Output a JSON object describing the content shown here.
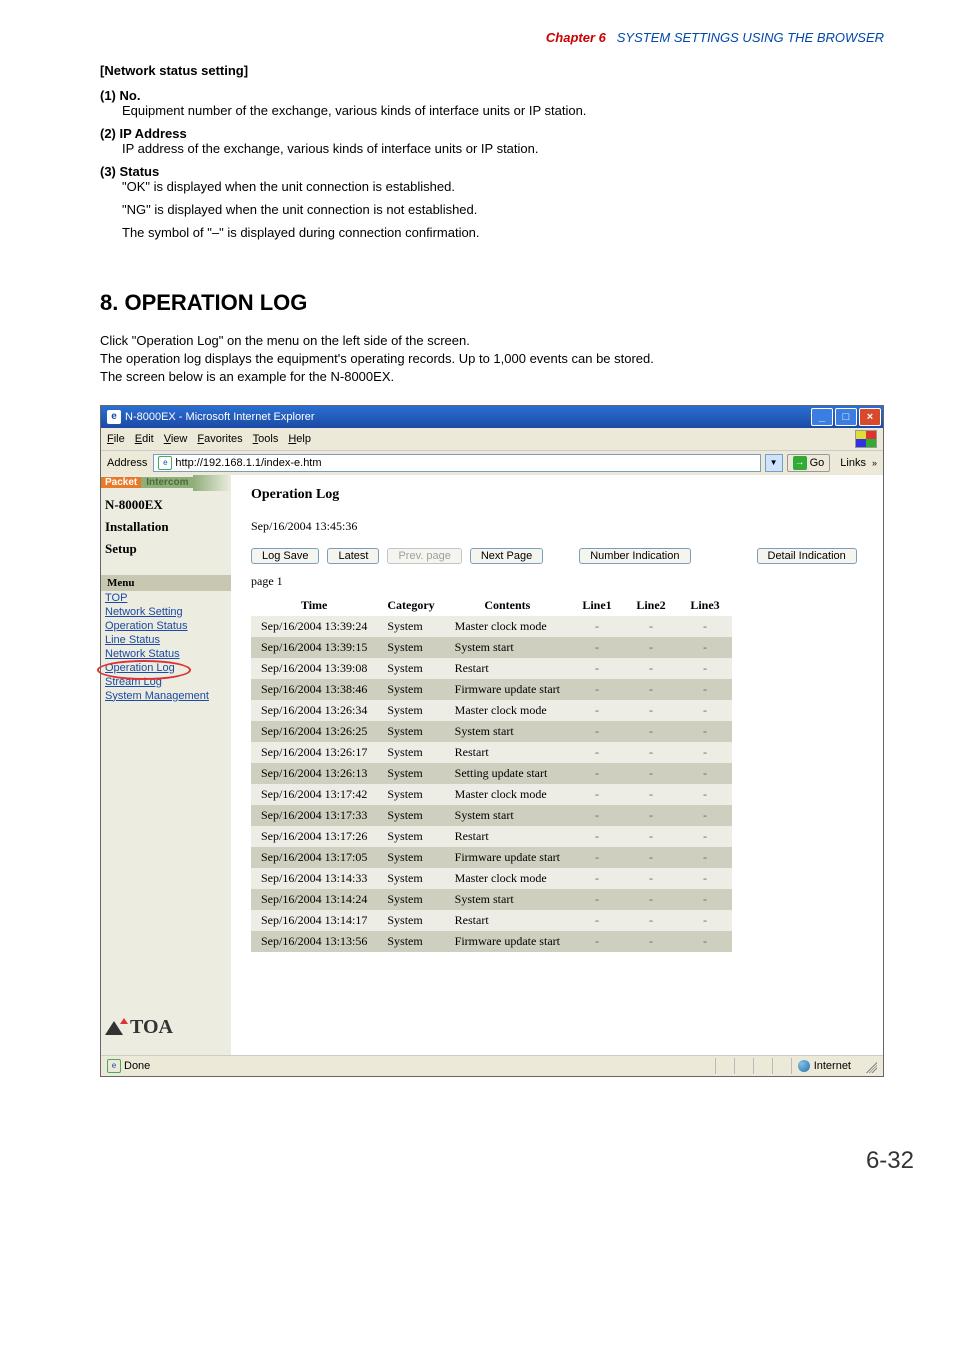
{
  "chapter": {
    "label": "Chapter 6",
    "title": "SYSTEM SETTINGS USING THE BROWSER"
  },
  "subheading": "[Network status setting]",
  "items": [
    {
      "num": "(1)",
      "label": "No.",
      "desc": "Equipment number of the exchange, various kinds of interface units or IP station."
    },
    {
      "num": "(2)",
      "label": "IP Address",
      "desc": "IP address of the exchange, various kinds of interface units or IP station."
    },
    {
      "num": "(3)",
      "label": "Status",
      "lines": [
        "\"OK\" is displayed when the unit connection is established.",
        "\"NG\" is displayed when the unit connection is not established.",
        "The symbol of \"–\" is displayed during connection confirmation."
      ]
    }
  ],
  "section8": {
    "heading": "8. OPERATION LOG",
    "para": [
      "Click \"Operation Log\" on the menu on the left side of the screen.",
      "The operation log displays the equipment's operating records. Up to 1,000 events can be stored.",
      "The screen below is an example for the N-8000EX."
    ]
  },
  "browser": {
    "title": "N-8000EX - Microsoft Internet Explorer",
    "menus": [
      "File",
      "Edit",
      "View",
      "Favorites",
      "Tools",
      "Help"
    ],
    "addr_label": "Address",
    "url": "http://192.168.1.1/index-e.htm",
    "go_label": "Go",
    "links_label": "Links",
    "status_done": "Done",
    "status_zone": "Internet"
  },
  "sidebar": {
    "brand1": "Packet",
    "brand2": "Intercom",
    "model": "N-8000EX",
    "line1": "Installation",
    "line2": "Setup",
    "menu_label": "Menu",
    "links": [
      "TOP",
      "Network Setting",
      "Operation Status",
      "Line Status",
      "Network Status",
      "Operation Log",
      "Stream Log",
      "System Management"
    ],
    "logo": "TOA"
  },
  "main": {
    "heading": "Operation Log",
    "timestamp": "Sep/16/2004 13:45:36",
    "buttons": {
      "log_save": "Log Save",
      "latest": "Latest",
      "prev": "Prev. page",
      "next": "Next Page",
      "number": "Number Indication",
      "detail": "Detail Indication"
    },
    "page_label": "page 1",
    "headers": [
      "Time",
      "Category",
      "Contents",
      "Line1",
      "Line2",
      "Line3"
    ],
    "rows": [
      {
        "t": "Sep/16/2004 13:39:24",
        "cat": "System",
        "c": "Master clock mode",
        "l1": "-",
        "l2": "-",
        "l3": "-"
      },
      {
        "t": "Sep/16/2004 13:39:15",
        "cat": "System",
        "c": "System start",
        "l1": "-",
        "l2": "-",
        "l3": "-"
      },
      {
        "t": "Sep/16/2004 13:39:08",
        "cat": "System",
        "c": "Restart",
        "l1": "-",
        "l2": "-",
        "l3": "-"
      },
      {
        "t": "Sep/16/2004 13:38:46",
        "cat": "System",
        "c": "Firmware update start",
        "l1": "-",
        "l2": "-",
        "l3": "-"
      },
      {
        "t": "Sep/16/2004 13:26:34",
        "cat": "System",
        "c": "Master clock mode",
        "l1": "-",
        "l2": "-",
        "l3": "-"
      },
      {
        "t": "Sep/16/2004 13:26:25",
        "cat": "System",
        "c": "System start",
        "l1": "-",
        "l2": "-",
        "l3": "-"
      },
      {
        "t": "Sep/16/2004 13:26:17",
        "cat": "System",
        "c": "Restart",
        "l1": "-",
        "l2": "-",
        "l3": "-"
      },
      {
        "t": "Sep/16/2004 13:26:13",
        "cat": "System",
        "c": "Setting update start",
        "l1": "-",
        "l2": "-",
        "l3": "-"
      },
      {
        "t": "Sep/16/2004 13:17:42",
        "cat": "System",
        "c": "Master clock mode",
        "l1": "-",
        "l2": "-",
        "l3": "-"
      },
      {
        "t": "Sep/16/2004 13:17:33",
        "cat": "System",
        "c": "System start",
        "l1": "-",
        "l2": "-",
        "l3": "-"
      },
      {
        "t": "Sep/16/2004 13:17:26",
        "cat": "System",
        "c": "Restart",
        "l1": "-",
        "l2": "-",
        "l3": "-"
      },
      {
        "t": "Sep/16/2004 13:17:05",
        "cat": "System",
        "c": "Firmware update start",
        "l1": "-",
        "l2": "-",
        "l3": "-"
      },
      {
        "t": "Sep/16/2004 13:14:33",
        "cat": "System",
        "c": "Master clock mode",
        "l1": "-",
        "l2": "-",
        "l3": "-"
      },
      {
        "t": "Sep/16/2004 13:14:24",
        "cat": "System",
        "c": "System start",
        "l1": "-",
        "l2": "-",
        "l3": "-"
      },
      {
        "t": "Sep/16/2004 13:14:17",
        "cat": "System",
        "c": "Restart",
        "l1": "-",
        "l2": "-",
        "l3": "-"
      },
      {
        "t": "Sep/16/2004 13:13:56",
        "cat": "System",
        "c": "Firmware update start",
        "l1": "-",
        "l2": "-",
        "l3": "-"
      }
    ]
  },
  "pageno": "6-32"
}
